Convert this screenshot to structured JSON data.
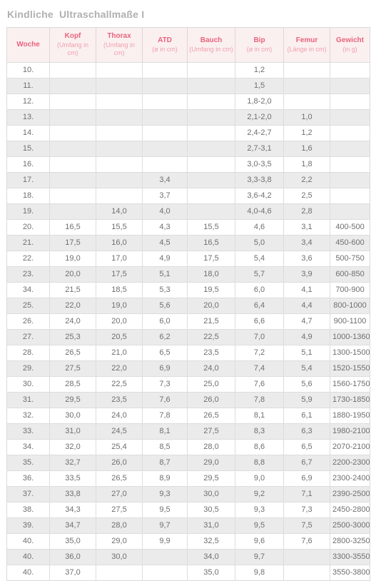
{
  "document": {
    "title": "Kindliche  Ultraschallmaße I"
  },
  "table": {
    "columns": [
      {
        "key": "woche",
        "main": "Woche",
        "sub": ""
      },
      {
        "key": "kopf",
        "main": "Kopf",
        "sub": "(Umfang in cm)"
      },
      {
        "key": "thorax",
        "main": "Thorax",
        "sub": "(Umfang in cm)"
      },
      {
        "key": "atd",
        "main": "ATD",
        "sub": "(ø in cm)"
      },
      {
        "key": "bauch",
        "main": "Bauch",
        "sub": "(Umfang in cm)"
      },
      {
        "key": "bip",
        "main": "Bip",
        "sub": "(ø in cm)"
      },
      {
        "key": "femur",
        "main": "Femur",
        "sub": "(Länge in cm)"
      },
      {
        "key": "gewicht",
        "main": "Gewicht",
        "sub": "(in g)"
      }
    ],
    "rows": [
      [
        "10.",
        "",
        "",
        "",
        "",
        "1,2",
        "",
        ""
      ],
      [
        "11.",
        "",
        "",
        "",
        "",
        "1,5",
        "",
        ""
      ],
      [
        "12.",
        "",
        "",
        "",
        "",
        "1,8-2,0",
        "",
        ""
      ],
      [
        "13.",
        "",
        "",
        "",
        "",
        "2,1-2,0",
        "1,0",
        ""
      ],
      [
        "14.",
        "",
        "",
        "",
        "",
        "2,4-2,7",
        "1,2",
        ""
      ],
      [
        "15.",
        "",
        "",
        "",
        "",
        "2,7-3,1",
        "1,6",
        ""
      ],
      [
        "16.",
        "",
        "",
        "",
        "",
        "3,0-3,5",
        "1,8",
        ""
      ],
      [
        "17.",
        "",
        "",
        "3,4",
        "",
        "3,3-3,8",
        "2,2",
        ""
      ],
      [
        "18.",
        "",
        "",
        "3,7",
        "",
        "3,6-4,2",
        "2,5",
        ""
      ],
      [
        "19.",
        "",
        "14,0",
        "4,0",
        "",
        "4,0-4,6",
        "2,8",
        ""
      ],
      [
        "20.",
        "16,5",
        "15,5",
        "4,3",
        "15,5",
        "4,6",
        "3,1",
        "400-500"
      ],
      [
        "21.",
        "17,5",
        "16,0",
        "4,5",
        "16,5",
        "5,0",
        "3,4",
        "450-600"
      ],
      [
        "22.",
        "19,0",
        "17,0",
        "4,9",
        "17,5",
        "5,4",
        "3,6",
        "500-750"
      ],
      [
        "23.",
        "20,0",
        "17,5",
        "5,1",
        "18,0",
        "5,7",
        "3,9",
        "600-850"
      ],
      [
        "34.",
        "21,5",
        "18,5",
        "5,3",
        "19,5",
        "6,0",
        "4,1",
        "700-900"
      ],
      [
        "25.",
        "22,0",
        "19,0",
        "5,6",
        "20,0",
        "6,4",
        "4,4",
        "800-1000"
      ],
      [
        "26.",
        "24,0",
        "20,0",
        "6,0",
        "21,5",
        "6,6",
        "4,7",
        "900-1100"
      ],
      [
        "27.",
        "25,3",
        "20,5",
        "6,2",
        "22,5",
        "7,0",
        "4,9",
        "1000-1360"
      ],
      [
        "28.",
        "26,5",
        "21,0",
        "6,5",
        "23,5",
        "7,2",
        "5,1",
        "1300-1500"
      ],
      [
        "29.",
        "27,5",
        "22,0",
        "6,9",
        "24,0",
        "7,4",
        "5,4",
        "1520-1550"
      ],
      [
        "30.",
        "28,5",
        "22,5",
        "7,3",
        "25,0",
        "7,6",
        "5,6",
        "1560-1750"
      ],
      [
        "31.",
        "29,5",
        "23,5",
        "7,6",
        "26,0",
        "7,8",
        "5,9",
        "1730-1850"
      ],
      [
        "32.",
        "30,0",
        "24,0",
        "7,8",
        "26,5",
        "8,1",
        "6,1",
        "1880-1950"
      ],
      [
        "33.",
        "31,0",
        "24,5",
        "8,1",
        "27,5",
        "8,3",
        "6,3",
        "1980-2100"
      ],
      [
        "34.",
        "32,0",
        "25,4",
        "8,5",
        "28,0",
        "8,6",
        "6,5",
        "2070-2100"
      ],
      [
        "35.",
        "32,7",
        "26,0",
        "8,7",
        "29,0",
        "8,8",
        "6,7",
        "2200-2300"
      ],
      [
        "36.",
        "33,5",
        "26,5",
        "8,9",
        "29,5",
        "9,0",
        "6,9",
        "2300-2400"
      ],
      [
        "37.",
        "33,8",
        "27,0",
        "9,3",
        "30,0",
        "9,2",
        "7,1",
        "2390-2500"
      ],
      [
        "38.",
        "34,3",
        "27,5",
        "9,5",
        "30,5",
        "9,3",
        "7,3",
        "2450-2800"
      ],
      [
        "39.",
        "34,7",
        "28,0",
        "9,7",
        "31,0",
        "9,5",
        "7,5",
        "2500-3000"
      ],
      [
        "40.",
        "35,0",
        "29,0",
        "9,9",
        "32,5",
        "9,6",
        "7,6",
        "2800-3250"
      ],
      [
        "40.",
        "36,0",
        "30,0",
        "",
        "34,0",
        "9,7",
        "",
        "3300-3550"
      ],
      [
        "40.",
        "37,0",
        "",
        "",
        "35,0",
        "9,8",
        "",
        "3550-3800"
      ]
    ]
  },
  "colors": {
    "title": "#b0b0b0",
    "header_bg": "#fbf0f0",
    "header_text": "#e8637c",
    "header_subtext": "#efa0ae",
    "row_odd_bg": "#ffffff",
    "row_even_bg": "#ebebeb",
    "body_text": "#6f6f6f",
    "border": "#dddddd"
  }
}
